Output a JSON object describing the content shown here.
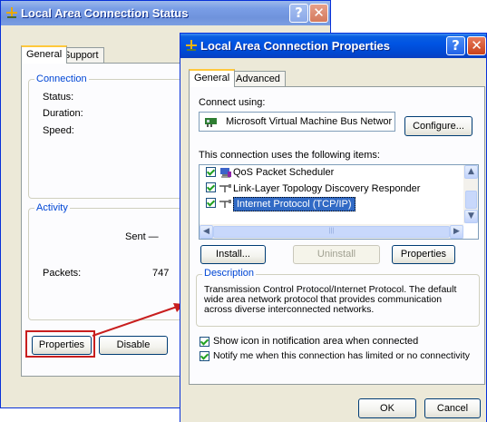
{
  "status_window": {
    "title": "Local Area Connection Status",
    "tabs": [
      "General",
      "Support"
    ],
    "connection_group": "Connection",
    "status_label": "Status:",
    "duration_label": "Duration:",
    "speed_label": "Speed:",
    "activity_group": "Activity",
    "sent_label": "Sent —",
    "packets_label": "Packets:",
    "packets_value": "747",
    "properties_button": "Properties",
    "disable_button": "Disable"
  },
  "properties_window": {
    "title": "Local Area Connection Properties",
    "tabs": [
      "General",
      "Advanced"
    ],
    "connect_using_label": "Connect using:",
    "adapter_name": "Microsoft Virtual Machine Bus Networ",
    "configure_button": "Configure...",
    "items_label": "This connection uses the following items:",
    "items": [
      {
        "label": "QoS Packet Scheduler",
        "checked": true,
        "selected": false
      },
      {
        "label": "Link-Layer Topology Discovery Responder",
        "checked": true,
        "selected": false
      },
      {
        "label": "Internet Protocol (TCP/IP)",
        "checked": true,
        "selected": true
      }
    ],
    "install_button": "Install...",
    "uninstall_button": "Uninstall",
    "properties_button": "Properties",
    "description_group": "Description",
    "description_text": "Transmission Control Protocol/Internet Protocol. The default wide area network protocol that provides communication across diverse interconnected networks.",
    "show_icon_label": "Show icon in notification area when connected",
    "show_icon_checked": true,
    "notify_label": "Notify me when this connection has limited or no connectivity",
    "notify_checked": true,
    "ok_button": "OK",
    "cancel_button": "Cancel"
  },
  "colors": {
    "title_active": "#0054e3",
    "title_inactive": "#7a9ee6",
    "window_face": "#ece9d8",
    "group_label": "#0046d5",
    "selection": "#316ac5",
    "highlight_box": "#c81e1e",
    "arrow": "#c81e1e"
  },
  "icons": [
    "network-connection-icon",
    "help-icon",
    "close-icon",
    "network-adapter-icon",
    "qos-icon",
    "protocol-icon",
    "scroll-up-icon",
    "scroll-down-icon",
    "scroll-left-icon",
    "scroll-right-icon"
  ]
}
